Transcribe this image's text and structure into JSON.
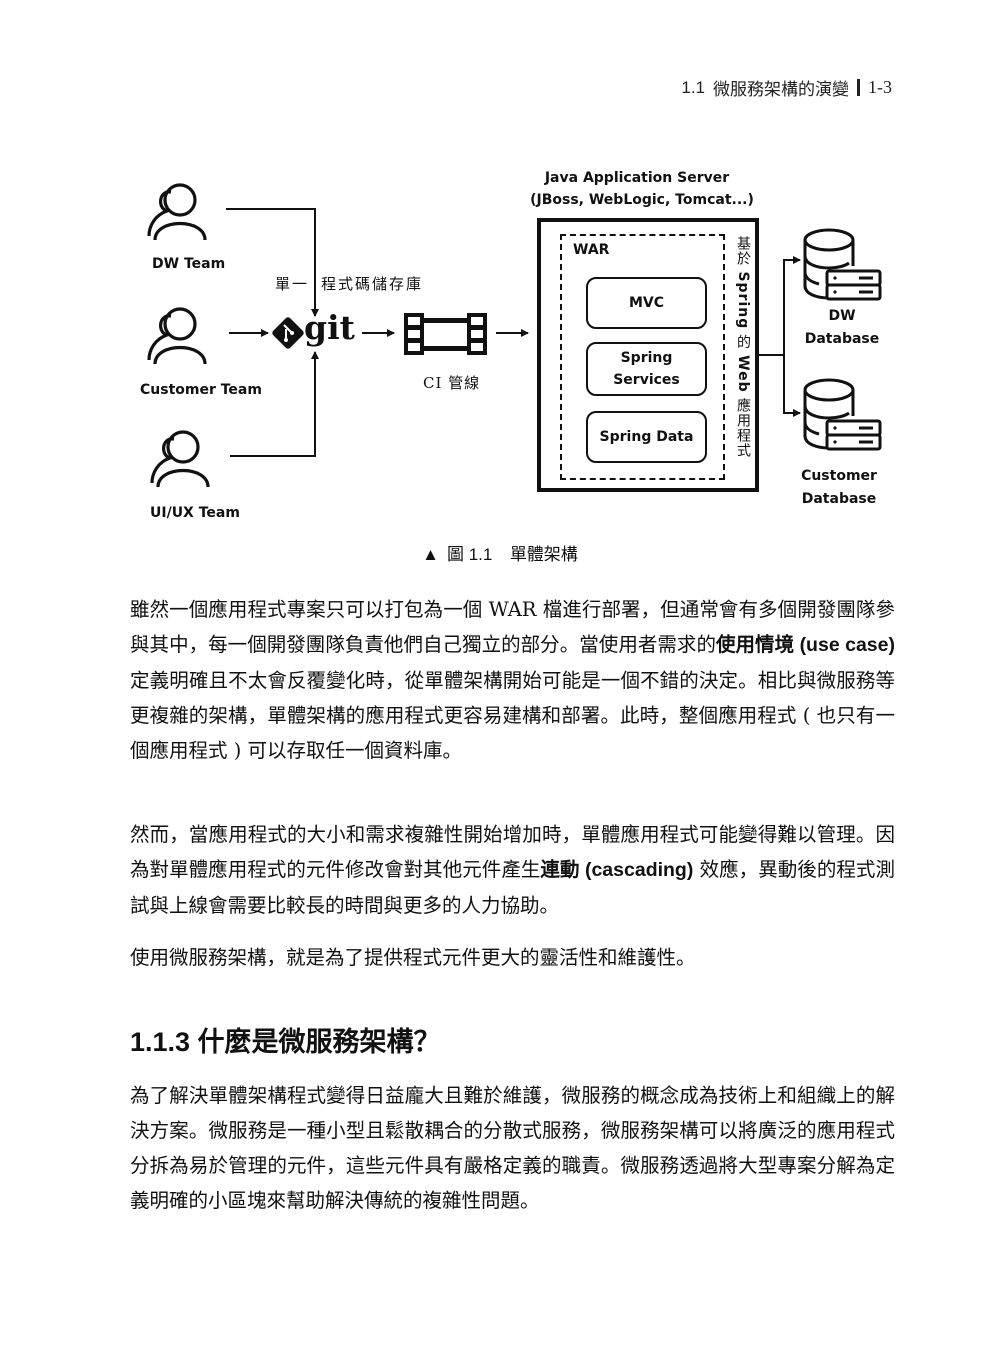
{
  "running_head": {
    "section": "1.1",
    "title": "微服務架構的演變",
    "page": "1-3"
  },
  "figure": {
    "teams": [
      {
        "label": "DW Team",
        "icon": "users-icon"
      },
      {
        "label": "Customer Team",
        "icon": "users-icon"
      },
      {
        "label": "UI/UX Team",
        "icon": "users-icon"
      }
    ],
    "repo_label_left": "單一",
    "repo_label_right": "程式碼儲存庫",
    "git_text": "git",
    "ci_label": "CI 管線",
    "server_title_line1": "Java Application Server",
    "server_title_line2": "(JBoss, WebLogic, Tomcat...)",
    "war_label": "WAR",
    "components": [
      "MVC",
      "Spring Services",
      "Spring Data"
    ],
    "components_lines": [
      [
        "MVC"
      ],
      [
        "Spring",
        "Services"
      ],
      [
        "Spring Data"
      ]
    ],
    "vertical_label": {
      "p1": "基於 ",
      "p2": "Spring",
      "p3": " 的 ",
      "p4": "Web",
      "p5": " 應用程式"
    },
    "databases": [
      {
        "line1": "DW",
        "line2": "Database",
        "icon": "database-server-icon"
      },
      {
        "line1": "Customer",
        "line2": "Database",
        "icon": "database-server-icon"
      }
    ],
    "caption": {
      "marker": "▲",
      "prefix": "圖 1.1",
      "title": "單體架構"
    }
  },
  "paragraphs": {
    "p1": {
      "a": "雖然一個應用程式專案只可以打包為一個 WAR 檔進行部署，但通常會有多個開發團隊參與其中，每一個開發團隊負責他們自己獨立的部分。當使用者需求的",
      "b_bold": "使用情境 (use case)",
      "c": " 定義明確且不太會反覆變化時，從單體架構開始可能是一個不錯的決定。相比與微服務等更複雜的架構，單體架構的應用程式更容易建構和部署。此時，整個應用程式 ( 也只有一個應用程式 ) 可以存取任一個資料庫。"
    },
    "p2": {
      "a": "然而，當應用程式的大小和需求複雜性開始增加時，單體應用程式可能變得難以管理。因為對單體應用程式的元件修改會對其他元件產生",
      "b_bold": "連動 (cascading)",
      "c": " 效應，異動後的程式測試與上線會需要比較長的時間與更多的人力協助。"
    },
    "p3": "使用微服務架構，就是為了提供程式元件更大的靈活性和維護性。",
    "heading": "1.1.3  什麼是微服務架構？",
    "p4": "為了解決單體架構程式變得日益龐大且難於維護，微服務的概念成為技術上和組織上的解決方案。微服務是一種小型且鬆散耦合的分散式服務，微服務架構可以將廣泛的應用程式分拆為易於管理的元件，這些元件具有嚴格定義的職責。微服務透過將大型專案分解為定義明確的小區塊來幫助解決傳統的複雜性問題。"
  }
}
